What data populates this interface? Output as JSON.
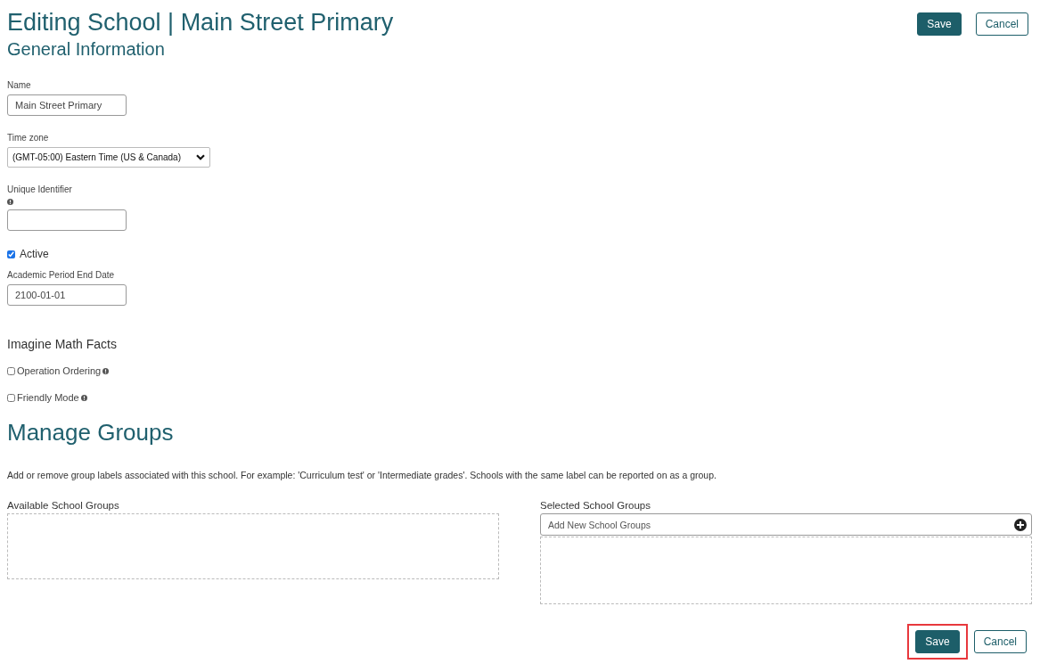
{
  "page": {
    "title": "Editing School | Main Street Primary",
    "subtitle": "General Information"
  },
  "top_buttons": [
    {
      "kind": "primary",
      "label": "Save",
      "highlighted": false
    },
    {
      "kind": "secondary",
      "label": "Cancel",
      "highlighted": false
    }
  ],
  "fields": [
    {
      "kind": "text",
      "label": "Name",
      "value": "Main Street Primary",
      "info": false
    },
    {
      "kind": "select",
      "label": "Time zone",
      "value": "(GMT-05:00) Eastern Time (US & Canada)",
      "info": false
    },
    {
      "kind": "text",
      "label": "Unique Identifier",
      "info": true
    },
    {
      "kind": "checkbox",
      "label": "Active",
      "checked": true
    },
    {
      "kind": "text",
      "label": "Academic Period End Date",
      "value": "2100-01-01",
      "info": false
    }
  ],
  "math_facts": {
    "heading": "Imagine Math Facts",
    "options": [
      {
        "label": "Operation Ordering",
        "checked": false
      },
      {
        "label": "Friendly Mode",
        "checked": false
      }
    ]
  },
  "groups": {
    "heading": "Manage Groups",
    "description": "Add or remove group labels associated with this school. For example: 'Curriculum test' or 'Intermediate grades'. Schools with the same label can be reported on as a group.",
    "available_label": "Available School Groups",
    "selected_label": "Selected School Groups",
    "add_placeholder": "Add New School Groups"
  },
  "bottom_buttons": [
    {
      "kind": "primary",
      "label": "Save",
      "highlighted": true
    },
    {
      "kind": "secondary",
      "label": "Cancel",
      "highlighted": false
    }
  ]
}
